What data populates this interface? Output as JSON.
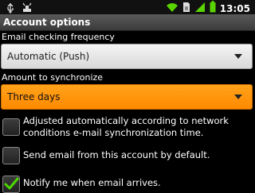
{
  "status_bar": {
    "time": "13:05",
    "icons": [
      "usb-icon",
      "debug-icon",
      "wifi-icon",
      "sim-icon",
      "signal-icon",
      "battery-icon"
    ]
  },
  "header": {
    "title": "Account options"
  },
  "settings": {
    "email_check_frequency": {
      "label": "Email checking frequency",
      "value": "Automatic (Push)"
    },
    "amount_to_sync": {
      "label": "Amount to synchronize",
      "value": "Three days"
    },
    "checkboxes": [
      {
        "text": "Adjusted automatically according to network conditions e-mail synchronization time.",
        "checked": false
      },
      {
        "text": "Send email from this account by default.",
        "checked": false
      },
      {
        "text": "Notify me when email arrives.",
        "checked": true
      }
    ]
  },
  "colors": {
    "accent": "#ff8c00",
    "check": "#4cd900",
    "wifi": "#5ad400"
  }
}
